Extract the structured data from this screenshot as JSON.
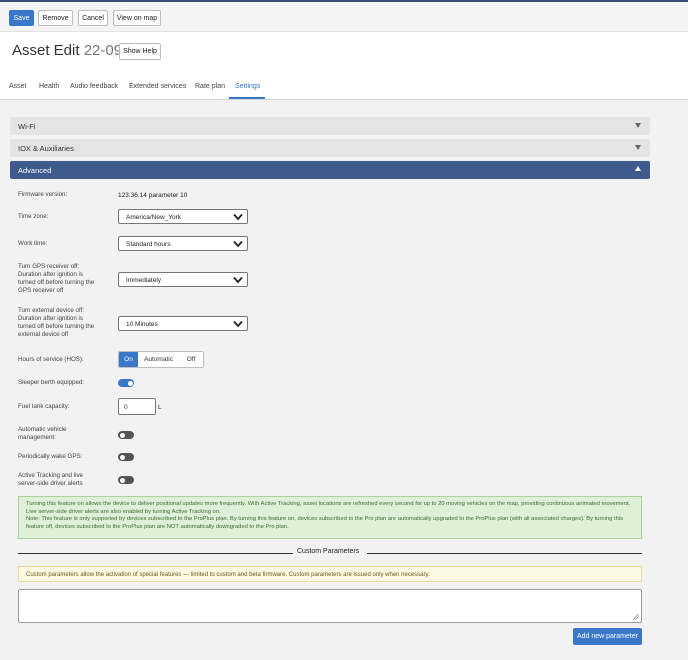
{
  "toolbar": {
    "save": "Save",
    "remove": "Remove",
    "cancel": "Cancel",
    "view_on_map": "View on map"
  },
  "header": {
    "title": "Asset Edit",
    "asset_id": "22-09",
    "show_help": "Show Help"
  },
  "tabs": [
    {
      "label": "Asset",
      "active": false
    },
    {
      "label": "Health",
      "active": false
    },
    {
      "label": "Audio feedback",
      "active": false
    },
    {
      "label": "Extended services",
      "active": false
    },
    {
      "label": "Rate plan",
      "active": false
    },
    {
      "label": "Settings",
      "active": true
    }
  ],
  "sections": {
    "wifi": "Wi-Fi",
    "iox": "IOX & Auxiliaries",
    "advanced": "Advanced"
  },
  "fields": {
    "firmware_label": "Firmware version:",
    "firmware_value": "123.36.14 parameter 10",
    "timezone_label": "Time zone:",
    "timezone_value": "America/New_York",
    "worktime_label": "Work time:",
    "worktime_value": "Standard hours",
    "gps_label": [
      "Turn GPS receiver off:",
      "Duration after ignition is",
      "turned off before turning the",
      "GPS receiver off"
    ],
    "gps_value": "Immediately",
    "ext_label": [
      "Turn external device off:",
      "Duration after ignition is",
      "turned off before turning the",
      "external device off"
    ],
    "ext_value": "10 Minutes",
    "hos_label": "Hours of service (HOS):",
    "hos_options": {
      "on": "On",
      "automatic": "Automatic",
      "off": "Off"
    },
    "hos_selected": "On",
    "sleeper_label": "Sleeper berth equipped:",
    "sleeper_on": true,
    "fuel_label": "Fuel tank capacity:",
    "fuel_value": "0",
    "fuel_unit": "L",
    "avm_label": [
      "Automatic vehicle",
      "management:"
    ],
    "avm_on": false,
    "wake_label": "Periodically wake GPS:",
    "wake_on": false,
    "active_label": [
      "Active Tracking and live",
      "server-side driver alerts"
    ],
    "active_on": false
  },
  "notes": {
    "active_tracking": "Turning this feature on allows the device to deliver positional updates more frequently. With Active Tracking, asset locations are refreshed every second for up to 20 moving vehicles on the map, providing continuous animated movement. Live server-side driver alerts are also enabled by turning Active Tracking on.",
    "active_tracking_note": "Note: This feature is only supported by devices subscribed to the ProPlus plan. By turning this feature on, devices subscribed to the Pro plan are automatically upgraded to the ProPlus plan (with all associated charges). By turning this feature off, devices subscribed to the ProPlus plan are NOT automatically downgraded to the Pro plan.",
    "custom_params": "Custom parameters allow the activation of special features — limited to custom and beta firmware. Custom parameters are issued only when necessary."
  },
  "custom_parameters": {
    "title": "Custom Parameters",
    "textarea_value": "",
    "add_button": "Add new parameter"
  },
  "icons": {
    "section_toggle": "triangle-icon",
    "select_arrow": "chevron-down-icon",
    "resize": "resize-handle-icon"
  },
  "colors": {
    "primary": "#3a77c9",
    "section_active": "#3f5a8c",
    "success_bg": "#dff0d8",
    "warning_bg": "#fcf8e3"
  }
}
